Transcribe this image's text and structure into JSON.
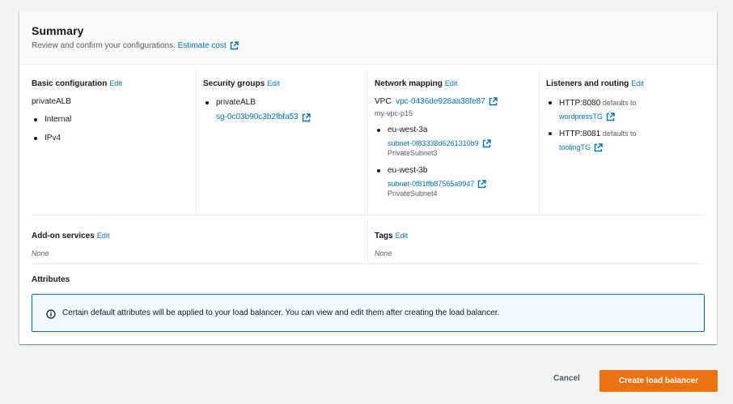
{
  "colors": {
    "accent": "#ec7211",
    "link": "#0073bb",
    "info_border": "#0073bb",
    "info_bg": "#f1faff"
  },
  "summary": {
    "title": "Summary",
    "subtitle": "Review and confirm your configurations.",
    "estimate_link": "Estimate cost",
    "icons": {
      "external": "external-link-icon",
      "info": "info-circle-icon"
    }
  },
  "basic": {
    "heading": "Basic configuration",
    "edit": "Edit",
    "name": "privateALB",
    "items": [
      "Internal",
      "IPv4"
    ]
  },
  "security": {
    "heading": "Security groups",
    "edit": "Edit",
    "group_name": "privateALB",
    "group_id": "sg-0c03b90c3b2fbfa53"
  },
  "network": {
    "heading": "Network mapping",
    "edit": "Edit",
    "vpc_label": "VPC",
    "vpc_id": "vpc-0436de928aa38fe87",
    "vpc_name": "my-vpc-p15",
    "zones": [
      {
        "az": "eu-west-3a",
        "subnet_id": "subnet-0f83338d6261310b9",
        "subnet_name": "PrivateSubnet3"
      },
      {
        "az": "eu-west-3b",
        "subnet_id": "subnet-0f81ffb87565a9947",
        "subnet_name": "PrivateSubnet4"
      }
    ]
  },
  "listeners": {
    "heading": "Listeners and routing",
    "edit": "Edit",
    "items": [
      {
        "listener": "HTTP:8080",
        "defaults": "defaults to",
        "target": "wordpressTG"
      },
      {
        "listener": "HTTP:8081",
        "defaults": "defaults to",
        "target": "toolingTG"
      }
    ]
  },
  "addons": {
    "heading": "Add-on services",
    "edit": "Edit",
    "value": "None"
  },
  "tags": {
    "heading": "Tags",
    "edit": "Edit",
    "value": "None"
  },
  "attributes": {
    "heading": "Attributes",
    "info": "Certain default attributes will be applied to your load balancer. You can view and edit them after creating the load balancer."
  },
  "footer": {
    "cancel": "Cancel",
    "create": "Create load balancer"
  }
}
